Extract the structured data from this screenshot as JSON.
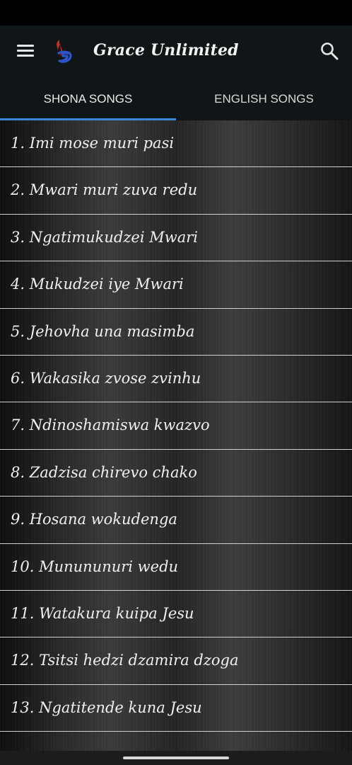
{
  "app": {
    "title": "Grace Unlimited"
  },
  "icons": {
    "menu": "menu-icon",
    "logo": "app-logo-icon",
    "search": "search-icon"
  },
  "colors": {
    "app_bar": "#101617",
    "tab_indicator": "#3b86d6",
    "logo_red": "#d42a2a",
    "logo_blue": "#2d54c8"
  },
  "tabs": [
    {
      "label": "SHONA SONGS",
      "selected": true
    },
    {
      "label": "ENGLISH SONGS",
      "selected": false
    }
  ],
  "songs": [
    "1. Imi mose muri pasi",
    "2. Mwari muri zuva redu",
    "3. Ngatimukudzei Mwari",
    "4. Mukudzei iye Mwari",
    "5. Jehovha una masimba",
    "6. Wakasika zvose zvinhu",
    "7. Ndinoshamiswa kwazvo",
    "8. Zadzisa chirevo chako",
    "9. Hosana wokudenga",
    "10. Munununuri wedu",
    "11. Watakura kuipa Jesu",
    "12. Tsitsi hedzi dzamira dzoga",
    "13. Ngatitende kuna Jesu"
  ]
}
